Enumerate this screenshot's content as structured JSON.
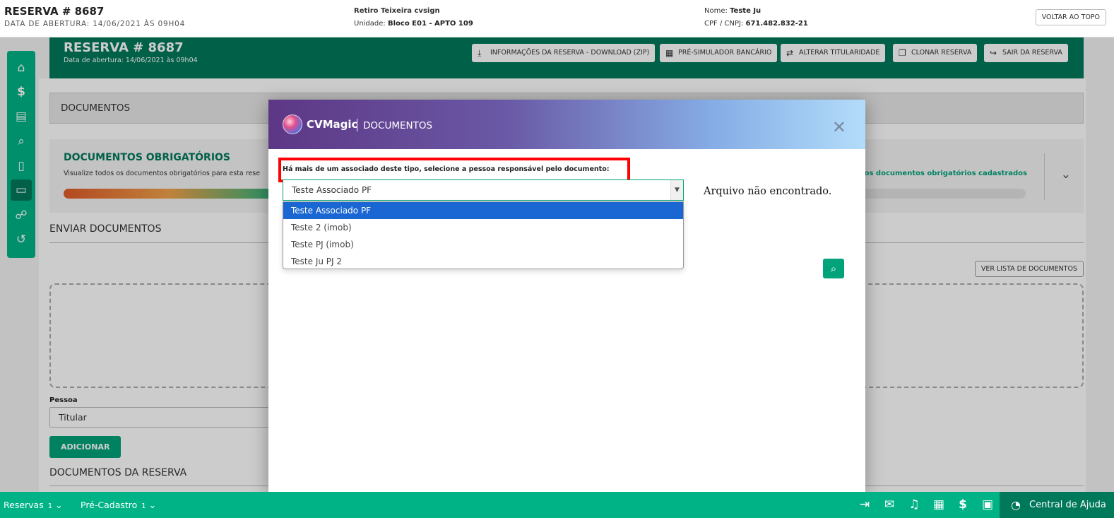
{
  "topbar": {
    "title": "RESERVA # 8687",
    "subtitle": "DATA DE ABERTURA: 14/06/2021 ÀS 09H04",
    "empreendimento": "Retiro Teixeira cvsign",
    "unidade_label": "Unidade:",
    "unidade_value": "Bloco E01 - APTO 109",
    "nome_label": "Nome:",
    "nome_value": "Teste Ju",
    "cpf_label": "CPF / CNPJ:",
    "cpf_value": "671.482.832-21",
    "back_to_top": "VOLTAR AO TOPO"
  },
  "header": {
    "title": "RESERVA # 8687",
    "subtitle": "Data de abertura: 14/06/2021 às 09h04",
    "buttons": [
      {
        "label": "INFORMAÇÕES DA RESERVA - DOWNLOAD (ZIP)",
        "icon": "download-icon"
      },
      {
        "label": "PRÉ-SIMULADOR BANCÁRIO",
        "icon": "calculator-icon"
      },
      {
        "label": "ALTERAR TITULARIDADE",
        "icon": "swap-icon"
      },
      {
        "label": "CLONAR RESERVA",
        "icon": "copy-icon"
      },
      {
        "label": "SAIR DA RESERVA",
        "icon": "exit-icon"
      }
    ]
  },
  "sidebar": {
    "items": [
      {
        "icon": "home-icon"
      },
      {
        "icon": "dollar-icon"
      },
      {
        "icon": "invoice-icon"
      },
      {
        "icon": "search-money-icon"
      },
      {
        "icon": "document-icon"
      },
      {
        "icon": "folder-icon",
        "active": true
      },
      {
        "icon": "chat-icon"
      },
      {
        "icon": "history-icon"
      }
    ]
  },
  "main": {
    "documents_title": "DOCUMENTOS",
    "required_title": "DOCUMENTOS OBRIGATÓRIOS",
    "required_desc": "Visualize todos os documentos obrigatórios para esta rese",
    "required_right": "os documentos obrigatórios cadastrados",
    "progress_fraction": 0.22,
    "send_title": "ENVIAR DOCUMENTOS",
    "view_list": "VER LISTA DE DOCUMENTOS",
    "pessoa_label": "Pessoa",
    "pessoa_value": "Titular",
    "add_button": "ADICIONAR",
    "reserve_docs_title": "DOCUMENTOS DA RESERVA"
  },
  "modal": {
    "brand": "CVMagic",
    "title": "DOCUMENTOS",
    "instruction": "Há mais de um associado deste tipo, selecione a pessoa responsável pelo documento:",
    "selected": "Teste Associado PF",
    "options": [
      "Teste Associado PF",
      "Teste 2 (imob)",
      "Teste PJ (imob)",
      "Teste Ju PJ 2"
    ],
    "not_found": "Arquivo não encontrado."
  },
  "bottombar": {
    "reservas_label": "Reservas",
    "reservas_count": "1",
    "precadastro_label": "Pré-Cadastro",
    "precadastro_count": "1",
    "help_label": "Central de Ajuda"
  },
  "colors": {
    "primary_green": "#00b386",
    "dark_green": "#00785a",
    "highlight_red": "#ff0000",
    "selected_blue": "#1a66d2"
  }
}
